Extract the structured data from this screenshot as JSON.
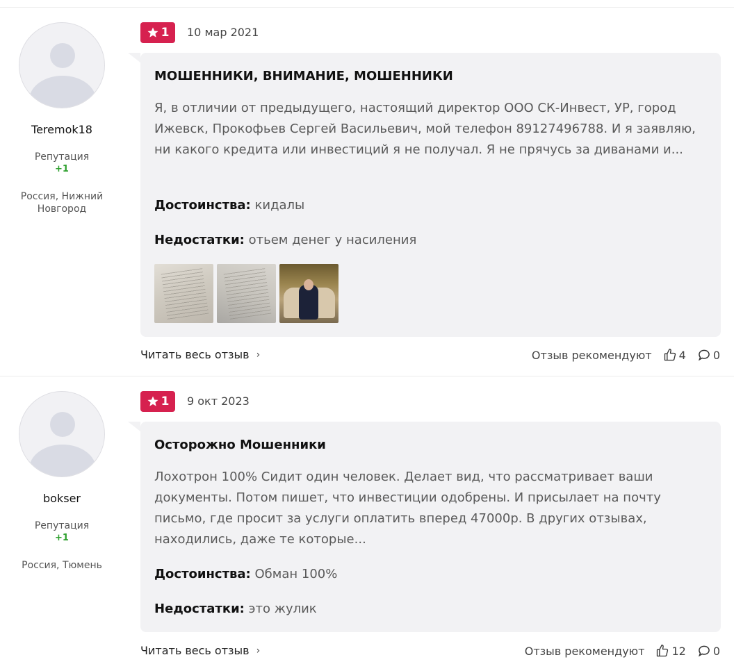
{
  "reviews": [
    {
      "username": "Teremok18",
      "reputation_label": "Репутация",
      "reputation_value": "+1",
      "location": "Россия, Нижний Новгород",
      "rating": "1",
      "date": "10 мар 2021",
      "title": "МОШЕННИКИ, ВНИМАНИЕ, МОШЕННИКИ",
      "text": "Я, в отличии от предыдущего, настоящий директор ООО СК-Инвест, УР, город Ижевск, Прокофьев Сергей Васильевич, мой телефон 89127496788. И я заявляю, ни какого кредита или инвестиций я не получал. Я не прячусь за диванами и...",
      "pros_label": "Достоинства:",
      "pros": "кидалы",
      "cons_label": "Недостатки:",
      "cons": "отьем денег у насиления",
      "read_more": "Читать весь отзыв",
      "recommend_label": "Отзыв рекомендуют",
      "likes": "4",
      "comments": "0"
    },
    {
      "username": "bokser",
      "reputation_label": "Репутация",
      "reputation_value": "+1",
      "location": "Россия, Тюмень",
      "rating": "1",
      "date": "9 окт 2023",
      "title": "Осторожно Мошенники",
      "text": "Лохотрон 100% Сидит один человек. Делает вид, что рассматривает ваши документы. Потом пишет, что инвестиции одобрены. И присылает на почту письмо, где просит за услуги оплатить вперед 47000р. В других отзывах, находились, даже те которые...",
      "pros_label": "Достоинства:",
      "pros": "Обман 100%",
      "cons_label": "Недостатки:",
      "cons": "это жулик",
      "read_more": "Читать весь отзыв",
      "recommend_label": "Отзыв рекомендуют",
      "likes": "12",
      "comments": "0"
    }
  ],
  "icons": {
    "star": "star-icon",
    "avatar": "avatar-placeholder",
    "thumb_up": "thumbs-up-icon",
    "comment": "comment-icon",
    "chevron": "chevron-right-icon"
  },
  "colors": {
    "badge": "#d6214f",
    "reputation": "#2ea02e",
    "card_bg": "#f2f2f4"
  }
}
